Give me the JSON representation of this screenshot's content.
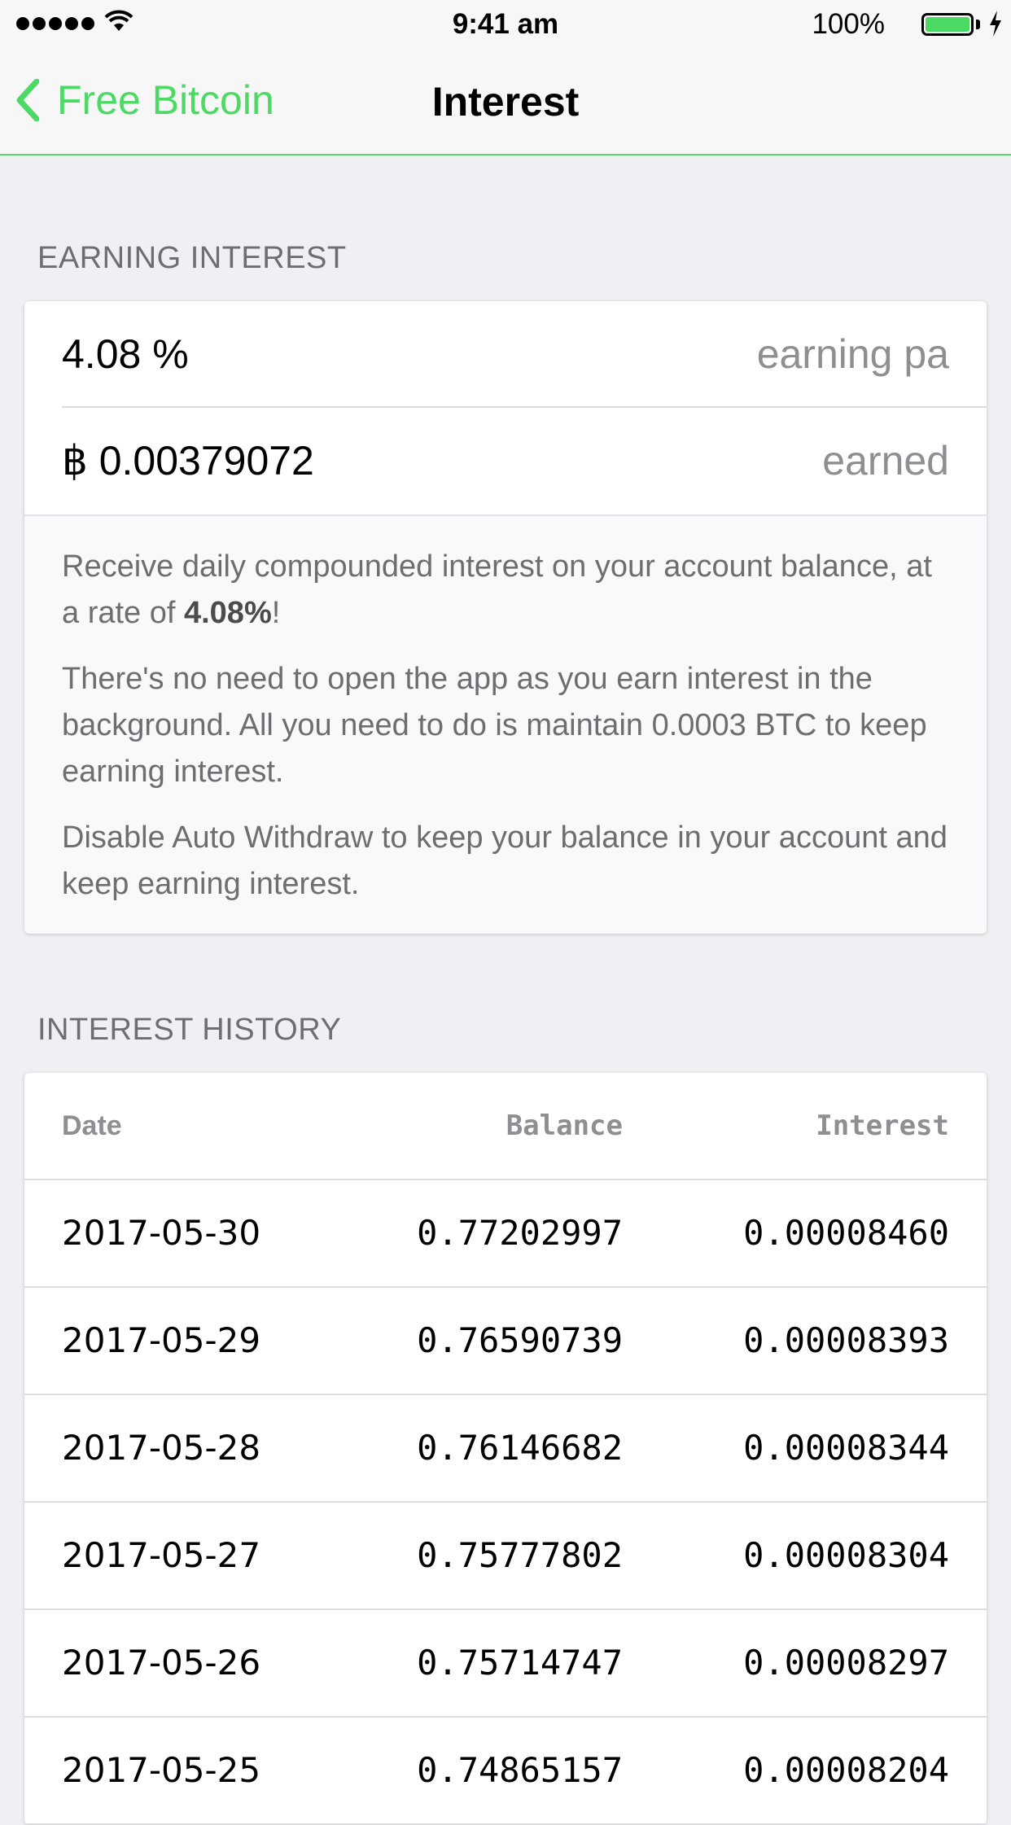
{
  "status_bar": {
    "time": "9:41 am",
    "battery_percent": "100%",
    "battery_level": 1.0,
    "signal_icon": "signal-dots-icon",
    "wifi_icon": "wifi-icon",
    "charging_icon": "lightning-bolt-icon"
  },
  "nav": {
    "back_label": "Free Bitcoin",
    "title": "Interest",
    "accent_color": "#4cd964"
  },
  "earning": {
    "header": "EARNING INTEREST",
    "rate_value": "4.08 %",
    "rate_label": "earning pa",
    "earned_value": "฿ 0.00379072",
    "earned_label": "earned",
    "info_p1_pre": "Receive daily compounded interest on your account balance, at a rate of ",
    "info_p1_rate": "4.08%",
    "info_p1_post": "!",
    "info_p2": "There's no need to open the app as you earn interest in the background. All you need to do is maintain 0.0003 BTC to keep earning interest.",
    "info_p3": "Disable Auto Withdraw to keep your balance in your account and keep earning interest."
  },
  "history": {
    "header": "INTEREST HISTORY",
    "columns": {
      "date": "Date",
      "balance": "Balance",
      "interest": "Interest"
    },
    "rows": [
      {
        "date": "2017-05-30",
        "balance": "0.77202997",
        "interest": "0.00008460"
      },
      {
        "date": "2017-05-29",
        "balance": "0.76590739",
        "interest": "0.00008393"
      },
      {
        "date": "2017-05-28",
        "balance": "0.76146682",
        "interest": "0.00008344"
      },
      {
        "date": "2017-05-27",
        "balance": "0.75777802",
        "interest": "0.00008304"
      },
      {
        "date": "2017-05-26",
        "balance": "0.75714747",
        "interest": "0.00008297"
      },
      {
        "date": "2017-05-25",
        "balance": "0.74865157",
        "interest": "0.00008204"
      }
    ]
  }
}
